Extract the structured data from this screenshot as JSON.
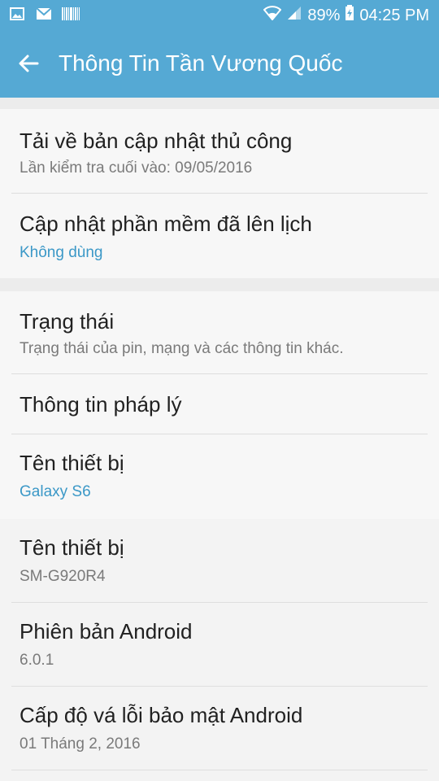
{
  "status": {
    "battery": "89%",
    "time": "04:25 PM"
  },
  "appbar": {
    "title": "Thông Tin Tần Vương Quốc"
  },
  "items": [
    {
      "title": "Tải về bản cập nhật thủ công",
      "subtitle": "Lần kiểm tra cuối vào: 09/05/2016"
    },
    {
      "title": "Cập nhật phần mềm đã lên lịch",
      "subtitle": "Không dùng"
    },
    {
      "title": "Trạng thái",
      "subtitle": "Trạng thái của pin, mạng và các thông tin khác."
    },
    {
      "title": "Thông tin pháp lý"
    },
    {
      "title": "Tên thiết bị",
      "subtitle": "Galaxy S6"
    },
    {
      "title": "Tên thiết bị",
      "subtitle": "SM-G920R4"
    },
    {
      "title": "Phiên bản Android",
      "subtitle": "6.0.1"
    },
    {
      "title": "Cấp độ vá lỗi bảo mật Android",
      "subtitle": "01 Tháng 2, 2016"
    }
  ],
  "colors": {
    "accent": "#55a9d4",
    "link": "#3b98c7"
  }
}
